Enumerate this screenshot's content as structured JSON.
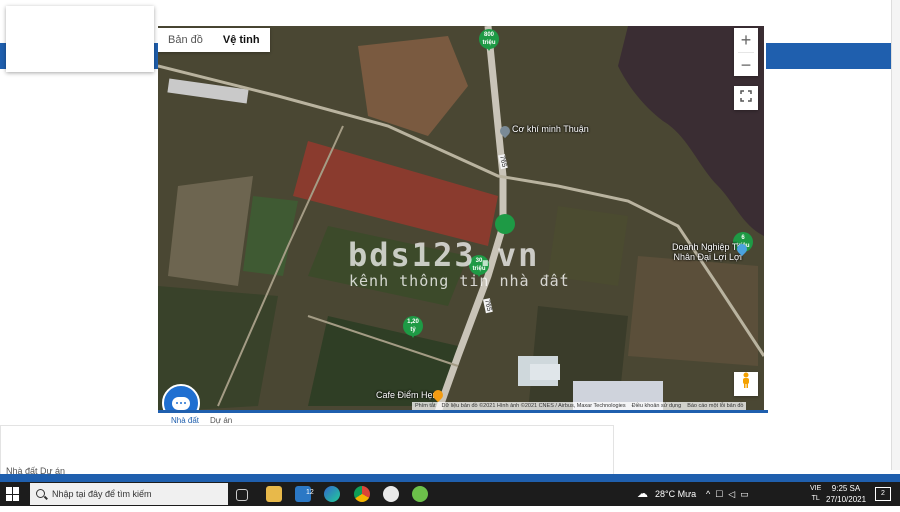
{
  "map": {
    "type_toggle": {
      "map_label": "Bản đồ",
      "satellite_label": "Vệ tinh",
      "active": "satellite"
    },
    "zoom_in": "+",
    "zoom_out": "−",
    "pins": [
      {
        "line1": "800",
        "line2": "triệu"
      },
      {
        "line1": "30",
        "line2": "triệu"
      },
      {
        "line1": "1,20",
        "line2": "tỷ"
      },
      {
        "line1": "6",
        "line2": "triệu"
      }
    ],
    "poi": {
      "co_khi": "Cơ khí minh Thuận",
      "doanh_nghiep_1": "Doanh Nghiệp Tư",
      "doanh_nghiep_2": "Nhân Đại Lợi Lợi",
      "cafe": "Cafe Điểm Hẹn"
    },
    "road_label_1": "765",
    "road_label_2": "765",
    "watermark": {
      "title": "bds123.vn",
      "subtitle": "kênh thông tin nhà đất"
    },
    "attribution": {
      "shortcuts": "Phím tắt",
      "data": "Dữ liệu bản đồ ©2021 Hình ảnh ©2021 CNES / Airbus, Maxar Technologies",
      "terms": "Điều khoản sử dụng",
      "report": "Báo cáo một lỗi bản đồ"
    },
    "colors": {
      "pin": "#1e9a45",
      "brand_blue": "#1f5fae",
      "chat": "#1f6fd1"
    }
  },
  "tabs": {
    "land": "Nhà đất",
    "project": "Dự án"
  },
  "background": {
    "bottom_text": "Nhà đất   Dự án"
  },
  "taskbar": {
    "search_placeholder": "Nhập tại đây để tìm kiếm",
    "weather": "28°C  Mưa",
    "lang_1": "VIE",
    "lang_2": "TL",
    "time": "9:25 SA",
    "date": "27/10/2021",
    "notification_count": "2",
    "mail_badge": "12",
    "icons": [
      "task-view-icon",
      "file-explorer-icon",
      "mail-icon",
      "edge-icon",
      "chrome-icon",
      "app-icon",
      "app2-icon"
    ]
  }
}
